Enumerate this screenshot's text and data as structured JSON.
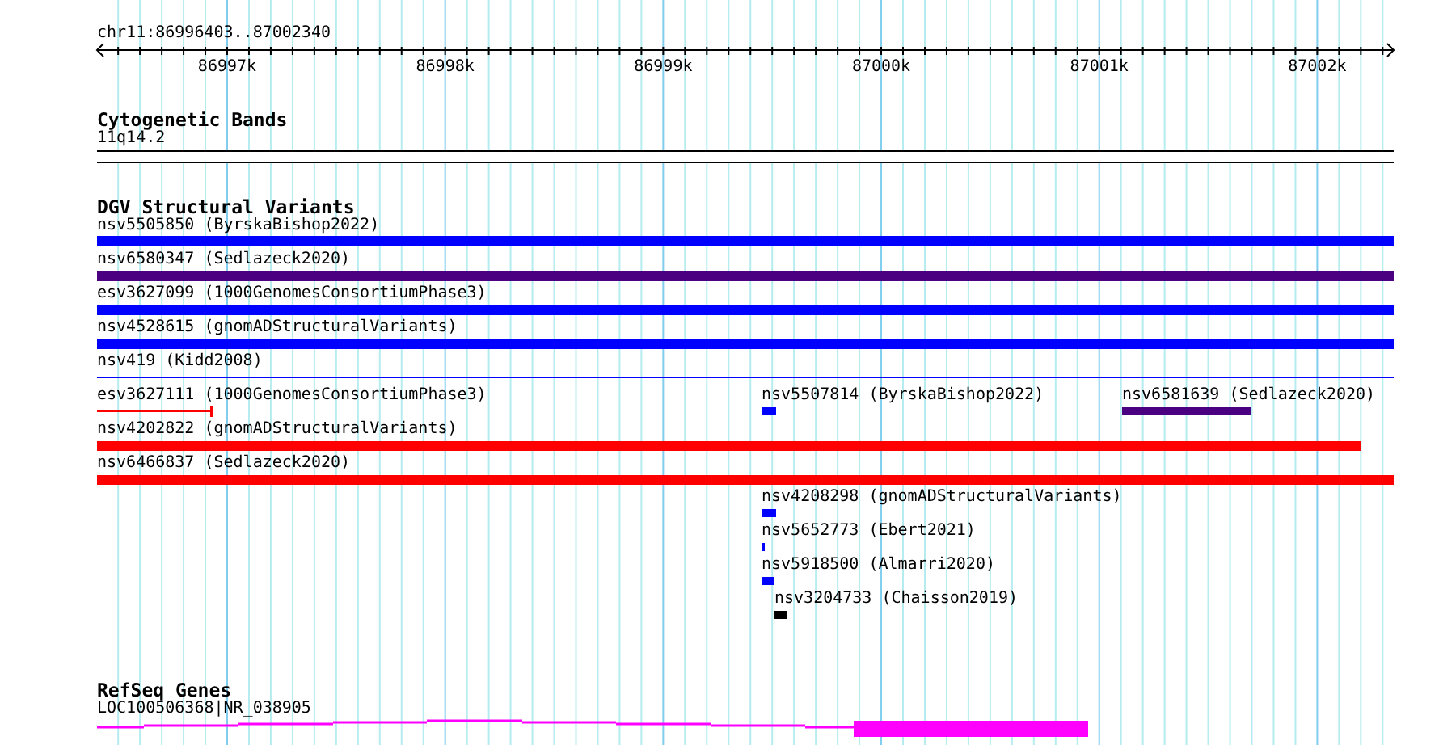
{
  "location": "chr11:86996403..87002340",
  "ruler": {
    "ticks": [
      "86997k",
      "86998k",
      "86999k",
      "87000k",
      "87001k",
      "87002k"
    ]
  },
  "tracks": [
    {
      "title": "Cytogenetic Bands",
      "features": [
        {
          "label": "11q14.2",
          "kind": "band"
        }
      ]
    },
    {
      "title": "DGV Structural Variants",
      "features": [
        {
          "label": "nsv5505850 (ByrskaBishop2022)",
          "color": "#0000ff",
          "kind": "bar"
        },
        {
          "label": "nsv6580347 (Sedlazeck2020)",
          "color": "#4b0082",
          "kind": "bar"
        },
        {
          "label": "esv3627099 (1000GenomesConsortiumPhase3)",
          "color": "#0000ff",
          "kind": "bar"
        },
        {
          "label": "nsv4528615 (gnomADStructuralVariants)",
          "color": "#0000ff",
          "kind": "bar"
        },
        {
          "label": "nsv419 (Kidd2008)",
          "color": "#0000ff",
          "kind": "line"
        },
        {
          "label": "esv3627111 (1000GenomesConsortiumPhase3)",
          "color": "#ff0000",
          "kind": "capped-line"
        },
        {
          "label": "nsv5507814 (ByrskaBishop2022)",
          "color": "#0000ff",
          "kind": "bar"
        },
        {
          "label": "nsv6581639 (Sedlazeck2020)",
          "color": "#4b0082",
          "kind": "bar"
        },
        {
          "label": "nsv4202822 (gnomADStructuralVariants)",
          "color": "#ff0000",
          "kind": "bar"
        },
        {
          "label": "nsv6466837 (Sedlazeck2020)",
          "color": "#ff0000",
          "kind": "bar"
        },
        {
          "label": "nsv4208298 (gnomADStructuralVariants)",
          "color": "#0000ff",
          "kind": "bar"
        },
        {
          "label": "nsv5652773 (Ebert2021)",
          "color": "#0000ff",
          "kind": "bar"
        },
        {
          "label": "nsv5918500 (Almarri2020)",
          "color": "#0000ff",
          "kind": "bar"
        },
        {
          "label": "nsv3204733 (Chaisson2019)",
          "color": "#000000",
          "kind": "bar"
        }
      ]
    },
    {
      "title": "RefSeq Genes",
      "features": [
        {
          "label": "LOC100506368|NR_038905",
          "color": "#ff00ff",
          "kind": "gene"
        }
      ]
    }
  ]
}
